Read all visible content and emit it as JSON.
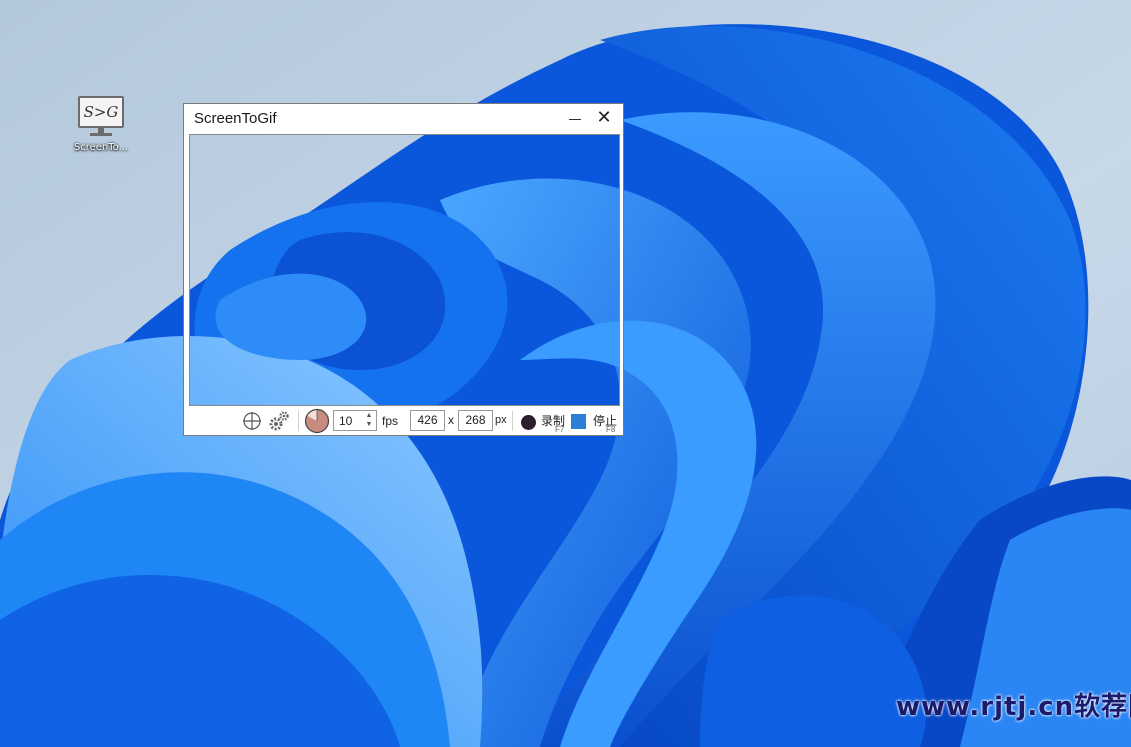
{
  "desktop": {
    "icon": {
      "glyph": "S>G",
      "label": "ScreenTo..."
    }
  },
  "window": {
    "title": "ScreenToGif",
    "close_glyph": "✕"
  },
  "toolbar": {
    "fps_value": "10",
    "fps_up": "▲",
    "fps_down": "▼",
    "fps_label": "fps",
    "width_value": "426",
    "times_label": "x",
    "height_value": "268",
    "px_label": "px",
    "record_label": "录制",
    "record_key": "F7",
    "stop_label": "停止",
    "stop_key": "F8"
  },
  "watermark": {
    "text": "www.rjtj.cn软荐网"
  },
  "colors": {
    "wallpaper_background": "#b9cde0",
    "bloom_blue": "#0a5fe0",
    "record_dot": "#2c1e2d",
    "stop_square": "#2b7fd4",
    "watermark": "#1b1b6e"
  },
  "icons": [
    "crosshair-icon",
    "gears-icon",
    "timer-icon",
    "record-dot-icon",
    "stop-square-icon",
    "minimize-icon",
    "close-icon"
  ]
}
